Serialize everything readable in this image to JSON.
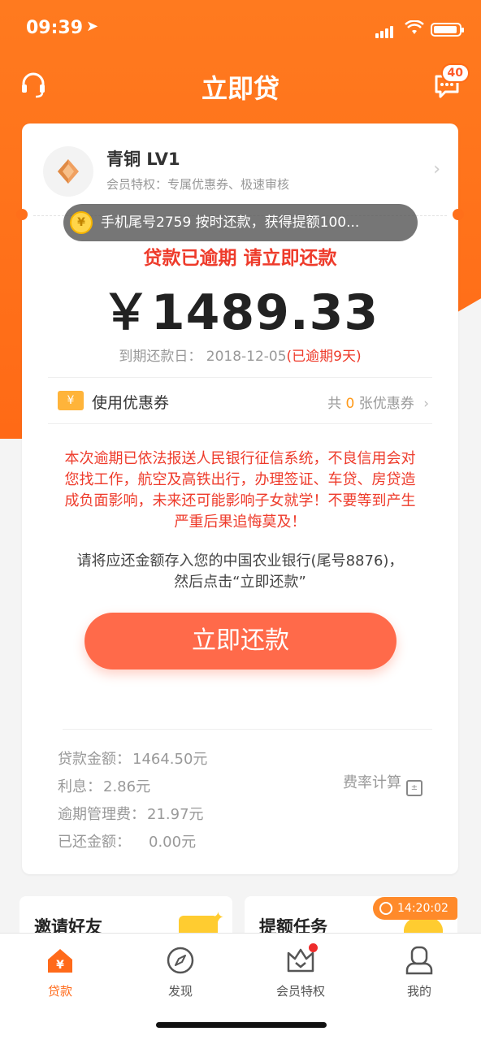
{
  "status_bar": {
    "time": "09:39"
  },
  "header": {
    "title": "立即贷",
    "message_badge": "40"
  },
  "level": {
    "name": "青铜 LV1",
    "desc": "会员特权：专属优惠券、极速审核"
  },
  "toast": {
    "coin": "¥",
    "text": "手机尾号2759 按时还款，获得提额100..."
  },
  "loan": {
    "overdue_text": "贷款已逾期 请立即还款",
    "amount": "￥1489.33",
    "due_label": "到期还款日：",
    "due_date": "2018-12-05",
    "overdue_days": "(已逾期9天)"
  },
  "coupon": {
    "icon": "¥",
    "label": "使用优惠券",
    "prefix": "共",
    "count": "0",
    "suffix": "张优惠券"
  },
  "warning": "本次逾期已依法报送人民银行征信系统，不良信用会对您找工作，航空及高铁出行，办理签证、车贷、房贷造成负面影响，未来还可能影响子女就学！不要等到产生严重后果追悔莫及！",
  "instruction": "请将应还金额存入您的中国农业银行(尾号8876)，然后点击“立即还款”",
  "repay_button": "立即还款",
  "details": {
    "principal_label": "贷款金额：",
    "principal": "1464.50元",
    "interest_label": "利息：",
    "interest": "2.86元",
    "fee_label": "逾期管理费：",
    "fee": "21.97元",
    "repaid_label": "已还金额：",
    "repaid": "0.00元",
    "rate_calc": "费率计算"
  },
  "cards": {
    "invite": "邀请好友",
    "task": "提额任务",
    "timer": "14:20:02"
  },
  "tabs": [
    {
      "label": "贷款",
      "icon": "home-icon"
    },
    {
      "label": "发现",
      "icon": "compass-icon"
    },
    {
      "label": "会员特权",
      "icon": "crown-icon"
    },
    {
      "label": "我的",
      "icon": "user-icon"
    }
  ],
  "colors": {
    "brand": "#ff6a16",
    "danger": "#ee3b2b",
    "button": "#ff6a4a"
  }
}
